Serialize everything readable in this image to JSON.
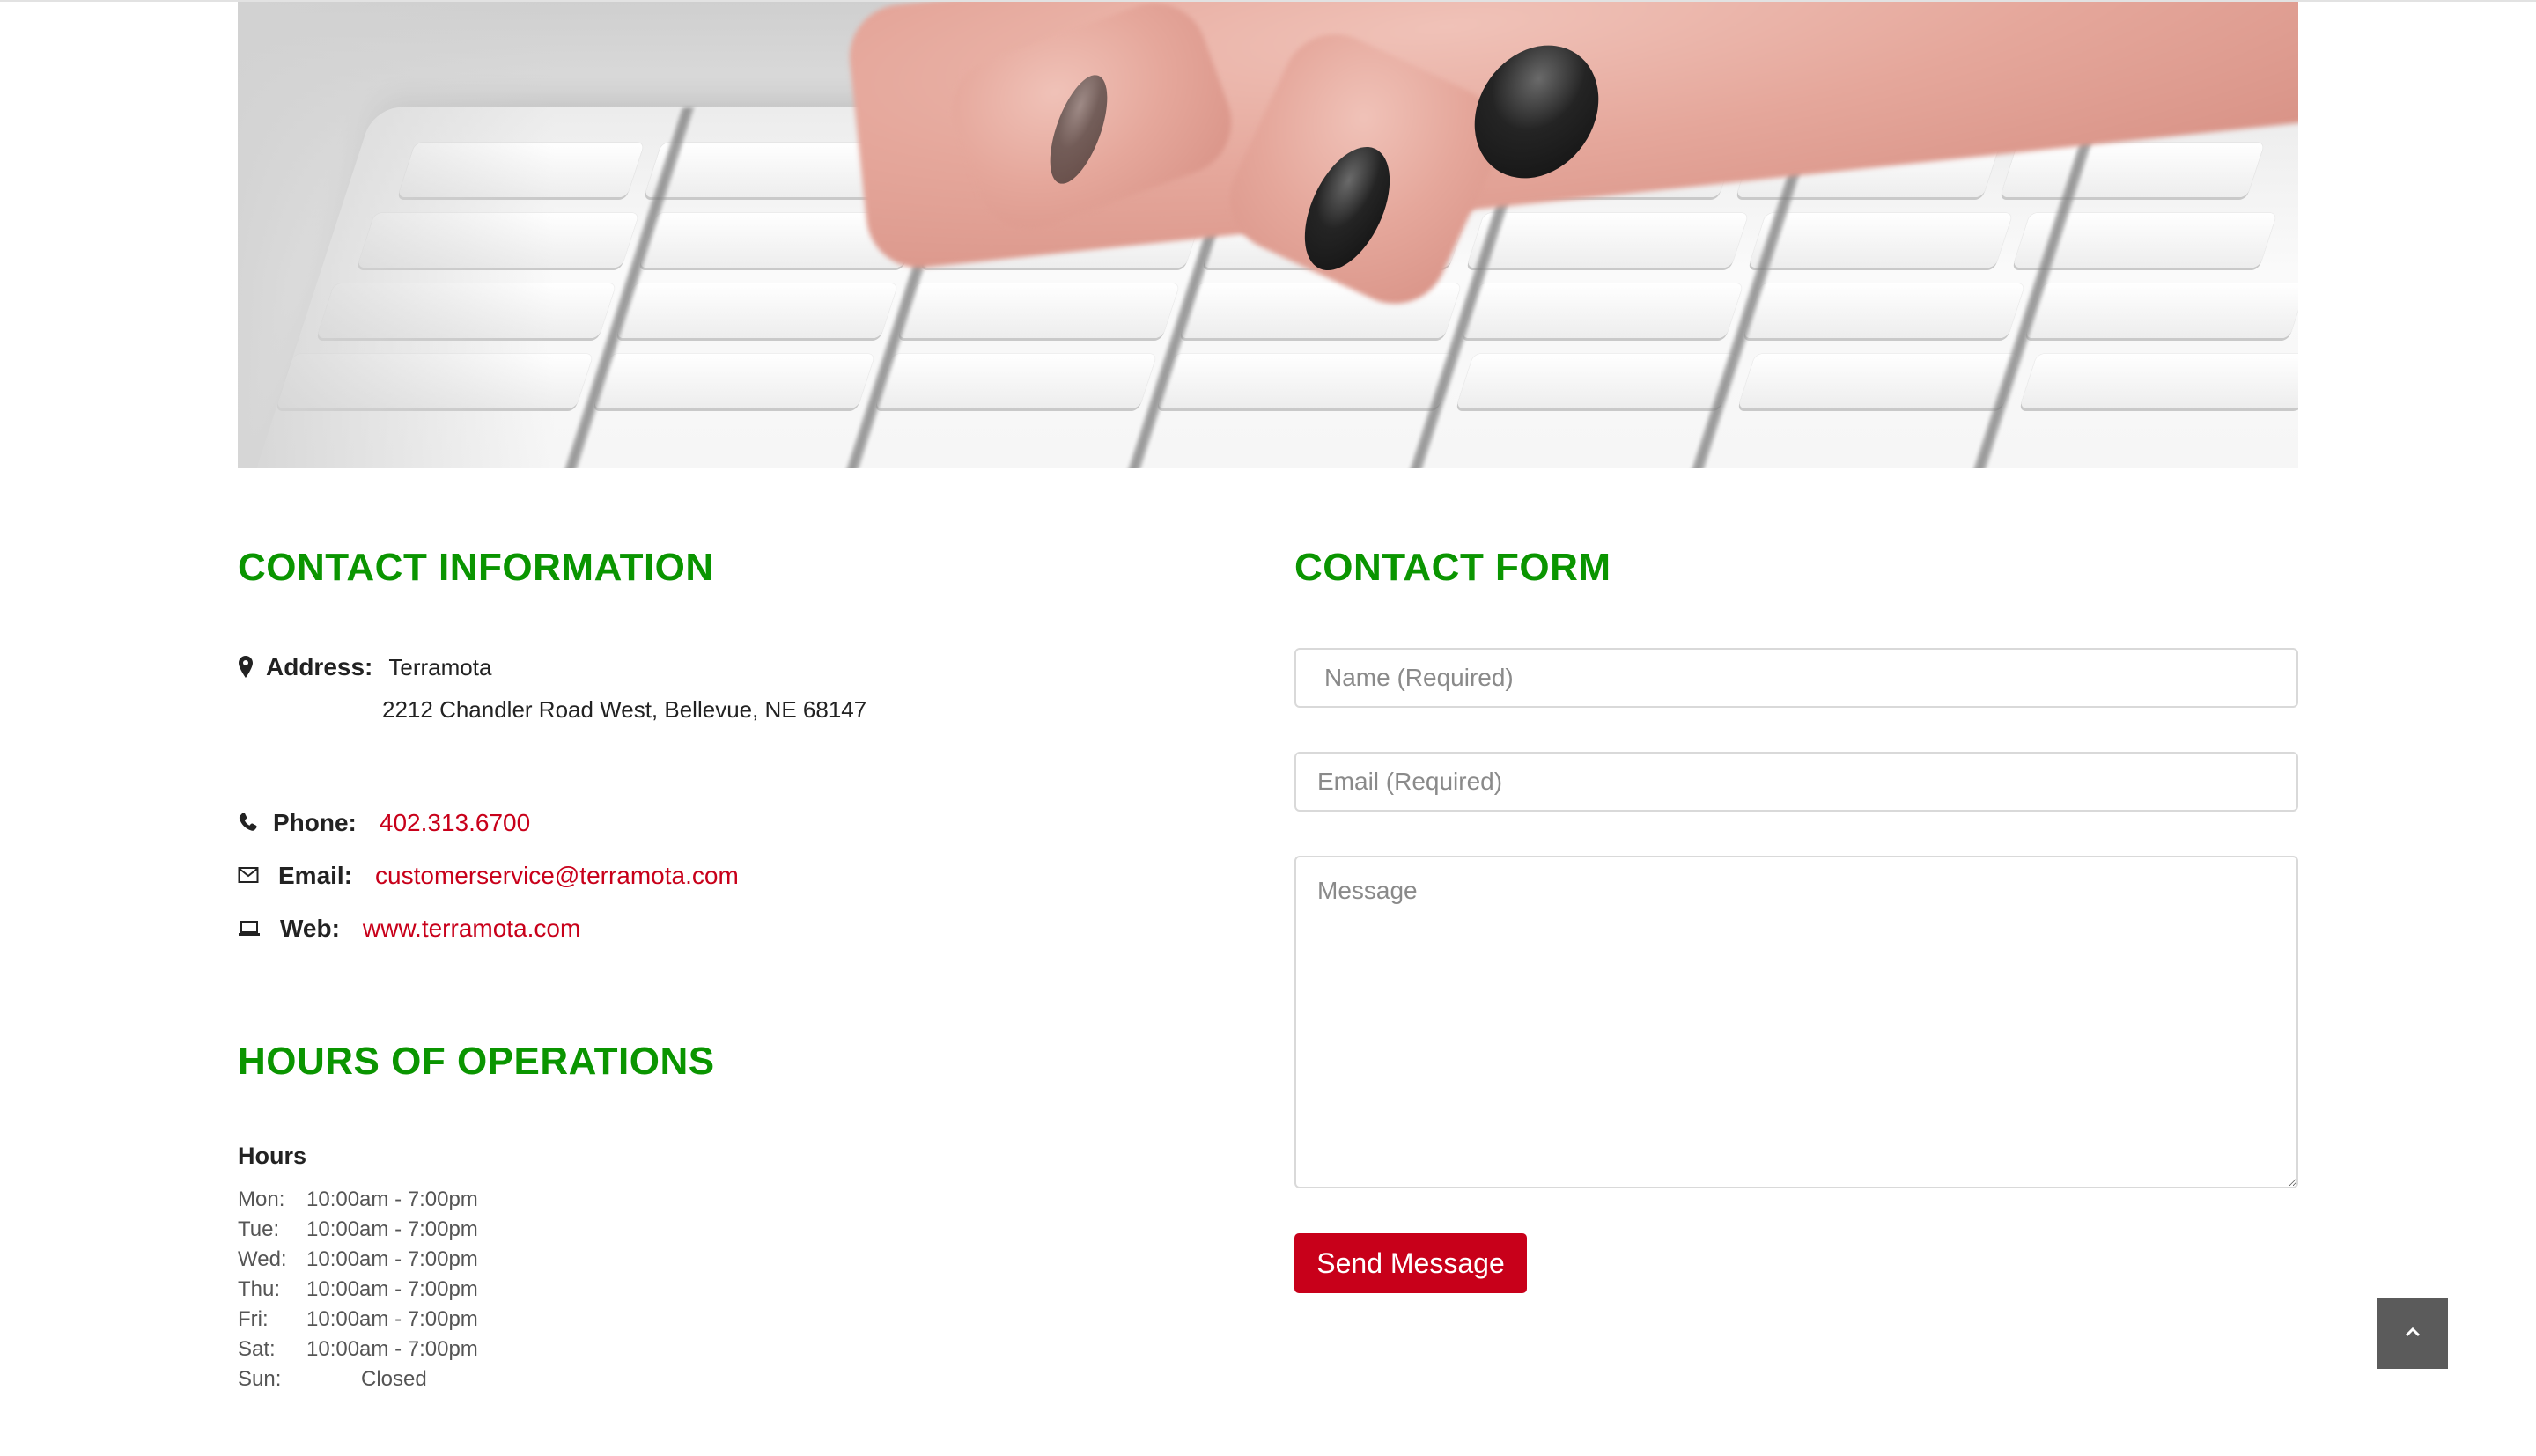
{
  "hero": {
    "alt": "Hands typing on a white keyboard"
  },
  "contact_info": {
    "heading": "CONTACT INFORMATION",
    "address_label": "Address:",
    "address_line1": "Terramota",
    "address_line2": "2212 Chandler Road West, Bellevue, NE 68147",
    "phone_label": "Phone:",
    "phone": "402.313.6700",
    "email_label": "Email:",
    "email": "customerservice@terramota.com",
    "web_label": "Web:",
    "web": "www.terramota.com"
  },
  "hours": {
    "heading": "HOURS OF OPERATIONS",
    "title": "Hours",
    "rows": [
      {
        "day": "Mon:",
        "time": "10:00am - 7:00pm"
      },
      {
        "day": "Tue:",
        "time": "10:00am - 7:00pm"
      },
      {
        "day": "Wed:",
        "time": "10:00am - 7:00pm"
      },
      {
        "day": "Thu:",
        "time": "10:00am - 7:00pm"
      },
      {
        "day": "Fri:",
        "time": "10:00am - 7:00pm"
      },
      {
        "day": "Sat:",
        "time": "10:00am - 7:00pm"
      },
      {
        "day": "Sun:",
        "time": "Closed"
      }
    ]
  },
  "contact_form": {
    "heading": "CONTACT FORM",
    "name_placeholder": "Name (Required)",
    "email_placeholder": "Email (Required)",
    "message_placeholder": "Message",
    "send_label": "Send Message"
  },
  "colors": {
    "heading_green": "#0a9500",
    "link_red": "#c8001a",
    "button_red": "#c8001a",
    "back_to_top_bg": "#5b5b5b"
  },
  "icons": {
    "address": "map-marker-icon",
    "phone": "phone-icon",
    "email": "envelope-icon",
    "web": "laptop-icon",
    "back_to_top": "chevron-up-icon"
  }
}
